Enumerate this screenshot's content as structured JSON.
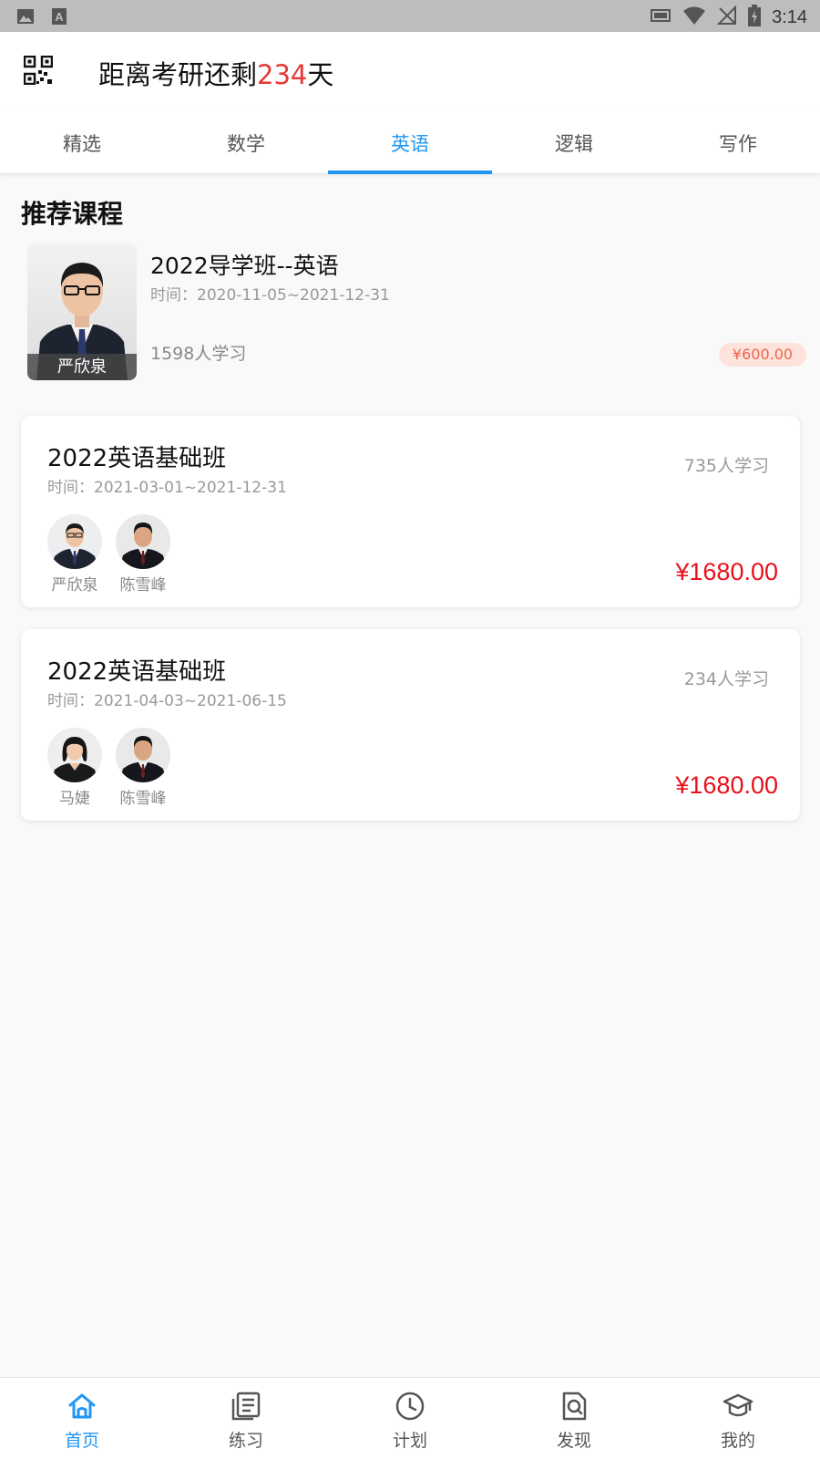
{
  "status_bar": {
    "time": "3:14"
  },
  "header": {
    "countdown_prefix": "距离考研还剩",
    "countdown_days": "234",
    "countdown_suffix": "天"
  },
  "tabs": [
    {
      "label": "精选",
      "active": false
    },
    {
      "label": "数学",
      "active": false
    },
    {
      "label": "英语",
      "active": true
    },
    {
      "label": "逻辑",
      "active": false
    },
    {
      "label": "写作",
      "active": false
    }
  ],
  "recommended": {
    "section_title": "推荐课程",
    "teacher": "严欣泉",
    "title": "2022导学班--英语",
    "time": "时间：2020-11-05~2021-12-31",
    "learners": "1598人学习",
    "price": "¥600.00"
  },
  "courses": [
    {
      "title": "2022英语基础班",
      "time": "时间：2021-03-01~2021-12-31",
      "learners": "735人学习",
      "price": "¥1680.00",
      "teachers": [
        "严欣泉",
        "陈雪峰"
      ]
    },
    {
      "title": "2022英语基础班",
      "time": "时间：2021-04-03~2021-06-15",
      "learners": "234人学习",
      "price": "¥1680.00",
      "teachers": [
        "马婕",
        "陈雪峰"
      ]
    }
  ],
  "bottom_nav": [
    {
      "label": "首页",
      "icon": "home-icon",
      "active": true
    },
    {
      "label": "练习",
      "icon": "practice-icon",
      "active": false
    },
    {
      "label": "计划",
      "icon": "clock-icon",
      "active": false
    },
    {
      "label": "发现",
      "icon": "discover-icon",
      "active": false
    },
    {
      "label": "我的",
      "icon": "graduation-cap-icon",
      "active": false
    }
  ],
  "colors": {
    "accent": "#2196f3",
    "countdown": "#e53935",
    "price": "#e8101b",
    "price_tag_bg": "#fde3dc",
    "price_tag_text": "#f0644a"
  }
}
